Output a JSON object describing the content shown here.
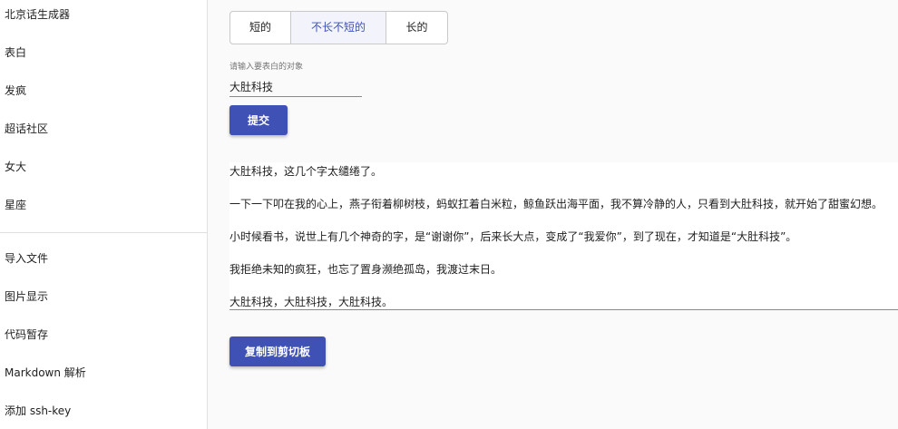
{
  "sidebar": {
    "items": [
      {
        "label": "北京话生成器"
      },
      {
        "label": "表白"
      },
      {
        "label": "发疯"
      },
      {
        "label": "超话社区"
      },
      {
        "label": "女大"
      },
      {
        "label": "星座"
      }
    ],
    "tools": [
      {
        "label": "导入文件"
      },
      {
        "label": "图片显示"
      },
      {
        "label": "代码暂存"
      },
      {
        "label": "Markdown 解析"
      },
      {
        "label": "添加 ssh-key"
      }
    ]
  },
  "main": {
    "length_options": [
      "短的",
      "不长不短的",
      "长的"
    ],
    "selected_length": "不长不短的",
    "input_label": "请输入要表白的对象",
    "input_value": "大肚科技",
    "submit_label": "提交",
    "output_lines": [
      "大肚科技，这几个字太缱绻了。",
      "一下一下叩在我的心上，燕子衔着柳树枝，蚂蚁扛着白米粒，鲸鱼跃出海平面，我不算冷静的人，只看到大肚科技，就开始了甜蜜幻想。",
      "小时候看书，说世上有几个神奇的字，是“谢谢你”，后来长大点，变成了“我爱你”，到了现在，才知道是“大肚科技”。",
      "我拒绝未知的疯狂，也忘了置身濒绝孤岛，我渡过末日。",
      "大肚科技，大肚科技，大肚科技。"
    ],
    "copy_label": "复制到剪切板"
  },
  "colors": {
    "primary": "#3f51b5",
    "background": "#fafafa"
  }
}
